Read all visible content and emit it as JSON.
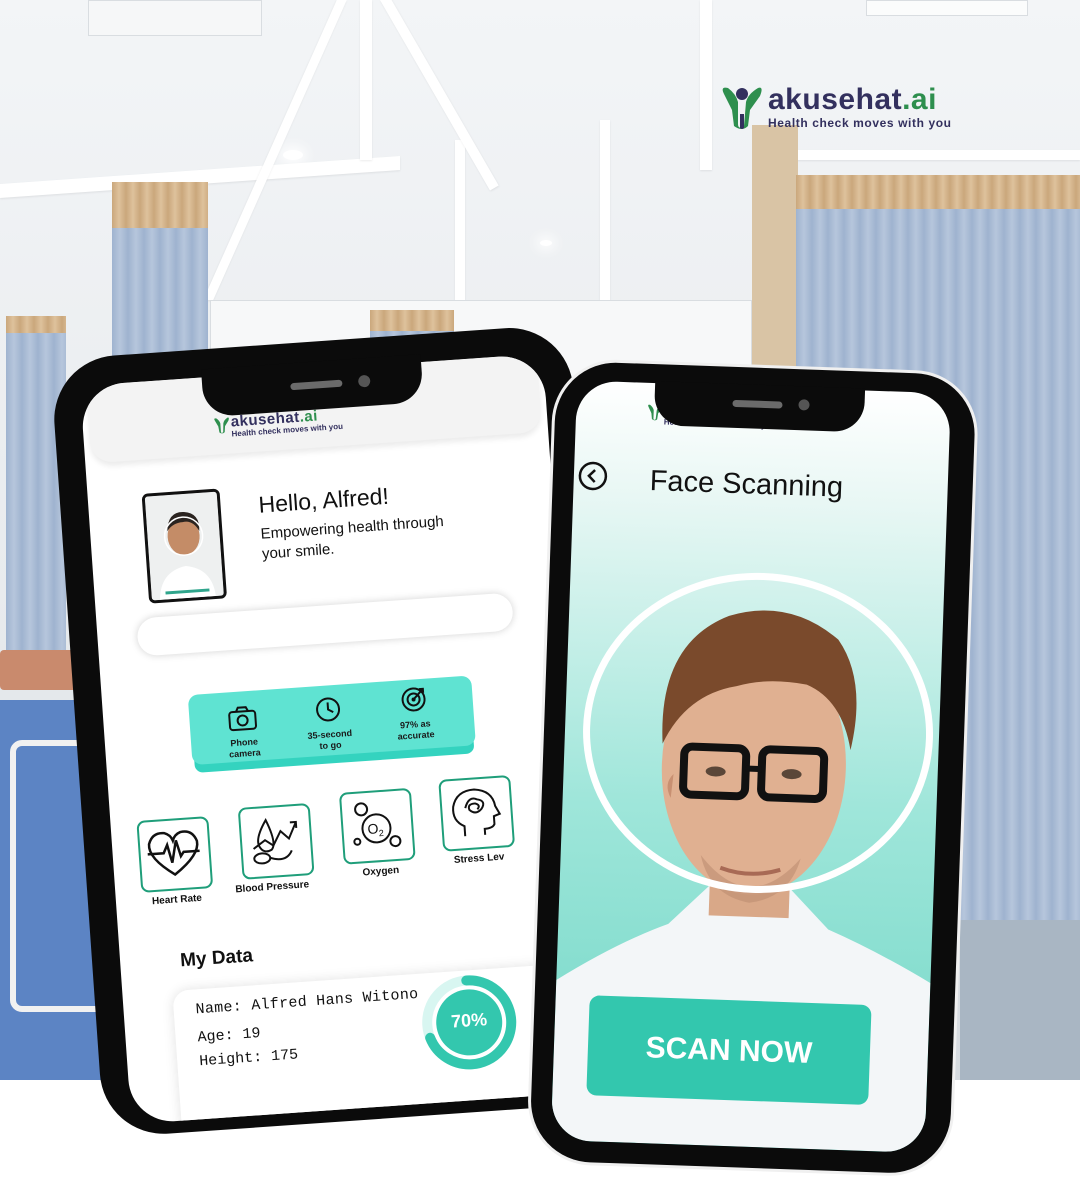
{
  "brand": {
    "name_main": "akusehat",
    "name_suffix": ".ai",
    "tagline": "Health check moves with you",
    "colors": {
      "navy": "#33305e",
      "green": "#2e8f4e",
      "teal": "#33c7ae",
      "teal_light": "#5fe3d2"
    }
  },
  "home_screen": {
    "greeting": "Hello, Alfred!",
    "subtitle_line1": "Empowering health through",
    "subtitle_line2": "your smile.",
    "search": {
      "value": ""
    },
    "features": [
      {
        "icon": "camera-icon",
        "line1": "Phone",
        "line2": "camera"
      },
      {
        "icon": "clock-icon",
        "line1": "35-second",
        "line2": "to go"
      },
      {
        "icon": "target-icon",
        "line1": "97% as",
        "line2": "accurate"
      }
    ],
    "metrics": [
      {
        "icon": "heart-rate-icon",
        "label": "Heart Rate"
      },
      {
        "icon": "blood-pressure-icon",
        "label": "Blood Pressure"
      },
      {
        "icon": "oxygen-icon",
        "label": "Oxygen",
        "symbol": "O",
        "subscript": "2"
      },
      {
        "icon": "stress-level-icon",
        "label": "Stress Lev"
      }
    ],
    "my_data": {
      "title": "My Data",
      "name": "Name: Alfred Hans Witono",
      "age": "Age: 19",
      "height": "Height: 175",
      "progress_label": "70%",
      "progress": 0.7
    }
  },
  "scan_screen": {
    "title": "Face Scanning",
    "button_label": "SCAN NOW"
  }
}
